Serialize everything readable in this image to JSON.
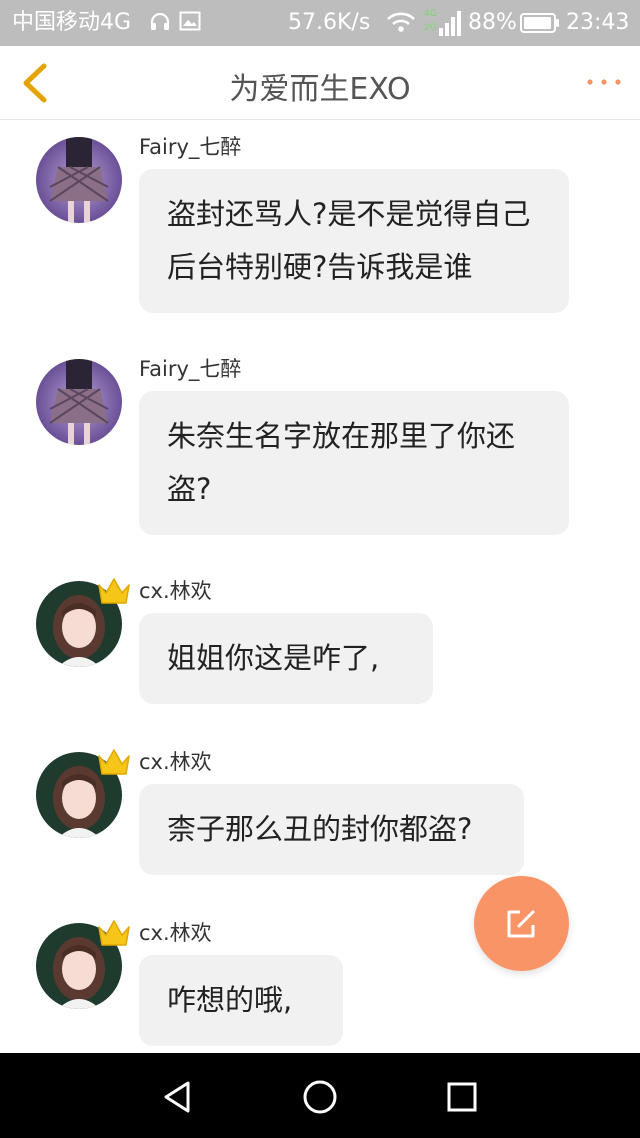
{
  "status_bar": {
    "carrier": "中国移动4G",
    "speed": "57.6K/s",
    "network_badge_top": "4G",
    "network_badge_bottom": "2G",
    "battery_percent": "88%",
    "time": "23:43"
  },
  "header": {
    "title": "为爱而生EXO"
  },
  "messages": [
    {
      "username": "Fairy_七醉",
      "text_lines": [
        "盗封还骂人?是不是觉得自己",
        "后台特别硬?告诉我是谁"
      ]
    },
    {
      "username": "Fairy_七醉",
      "text_lines": [
        "朱奈生名字放在那里了你还",
        "盗?"
      ]
    },
    {
      "username": "cx.林欢",
      "text_lines": [
        "姐姐你这是咋了,"
      ]
    },
    {
      "username": "cx.林欢",
      "text_lines": [
        "柰子那么丑的封你都盗?"
      ]
    },
    {
      "username": "cx.林欢",
      "text_lines": [
        "咋想的哦,"
      ]
    }
  ],
  "colors": {
    "accent": "#f99466",
    "back_arrow": "#e3a400",
    "bubble": "#f1f1f1",
    "status_bar": "#bdbdbd",
    "crown": "#f5c518"
  },
  "icons": {
    "back": "chevron-left-icon",
    "more": "more-dots-icon",
    "compose": "edit-icon",
    "nav_back": "triangle-back-icon",
    "nav_home": "circle-home-icon",
    "nav_recent": "square-recent-icon"
  }
}
